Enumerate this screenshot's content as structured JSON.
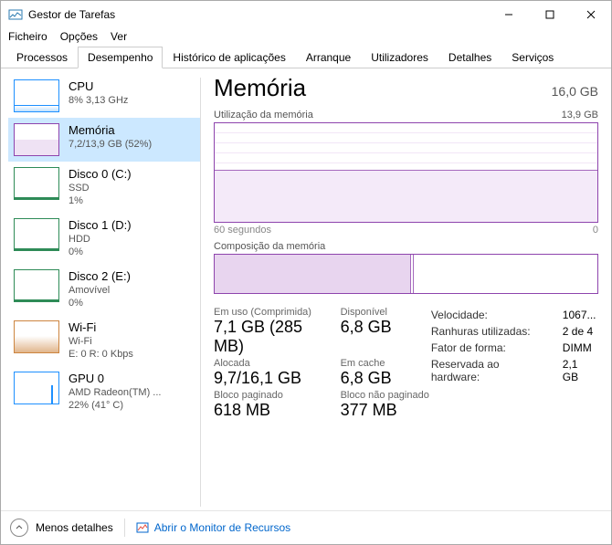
{
  "window": {
    "title": "Gestor de Tarefas"
  },
  "menu": {
    "file": "Ficheiro",
    "options": "Opções",
    "view": "Ver"
  },
  "tabs": {
    "processes": "Processos",
    "performance": "Desempenho",
    "history": "Histórico de aplicações",
    "startup": "Arranque",
    "users": "Utilizadores",
    "details": "Detalhes",
    "services": "Serviços"
  },
  "sidebar": {
    "cpu": {
      "title": "CPU",
      "sub1": "8% 3,13 GHz"
    },
    "mem": {
      "title": "Memória",
      "sub1": "7,2/13,9 GB (52%)"
    },
    "disk0": {
      "title": "Disco 0 (C:)",
      "sub1": "SSD",
      "sub2": "1%"
    },
    "disk1": {
      "title": "Disco 1 (D:)",
      "sub1": "HDD",
      "sub2": "0%"
    },
    "disk2": {
      "title": "Disco 2 (E:)",
      "sub1": "Amovível",
      "sub2": "0%"
    },
    "wifi": {
      "title": "Wi-Fi",
      "sub1": "Wi-Fi",
      "sub2": "E: 0 R: 0 Kbps"
    },
    "gpu": {
      "title": "GPU 0",
      "sub1": "AMD Radeon(TM) ...",
      "sub2": "22% (41° C)"
    }
  },
  "main": {
    "title": "Memória",
    "total": "16,0 GB",
    "chart_label": "Utilização da memória",
    "chart_max": "13,9 GB",
    "axis_left": "60 segundos",
    "axis_right": "0",
    "comp_label": "Composição da memória",
    "stats": {
      "inuse_lbl": "Em uso (Comprimida)",
      "inuse_val": "7,1 GB (285 MB)",
      "avail_lbl": "Disponível",
      "avail_val": "6,8 GB",
      "committed_lbl": "Alocada",
      "committed_val": "9,7/16,1 GB",
      "cached_lbl": "Em cache",
      "cached_val": "6,8 GB",
      "paged_lbl": "Bloco paginado",
      "paged_val": "618 MB",
      "nonpaged_lbl": "Bloco não paginado",
      "nonpaged_val": "377 MB"
    },
    "hw": {
      "speed_lbl": "Velocidade:",
      "speed_val": "1067...",
      "slots_lbl": "Ranhuras utilizadas:",
      "slots_val": "2 de 4",
      "form_lbl": "Fator de forma:",
      "form_val": "DIMM",
      "reserved_lbl": "Reservada ao hardware:",
      "reserved_val": "2,1 GB"
    }
  },
  "footer": {
    "less": "Menos detalhes",
    "resmon": "Abrir o Monitor de Recursos"
  },
  "chart_data": {
    "type": "area",
    "title": "Utilização da memória",
    "xlabel": "60 segundos → 0",
    "ylabel": "GB",
    "ylim": [
      0,
      13.9
    ],
    "x_range_seconds": [
      60,
      0
    ],
    "series": [
      {
        "name": "Em uso",
        "approx_constant_gb": 7.2
      }
    ],
    "composition": {
      "total_gb": 13.9,
      "segments": [
        {
          "name": "Em uso",
          "approx_gb": 7.1
        },
        {
          "name": "Disponível",
          "approx_gb": 6.8
        }
      ]
    }
  }
}
